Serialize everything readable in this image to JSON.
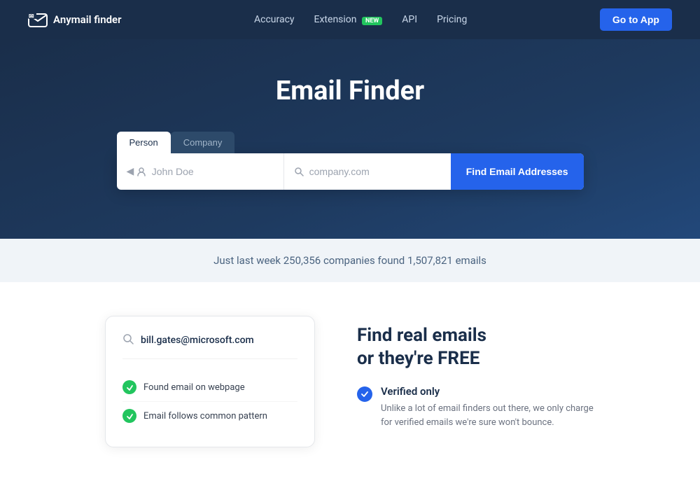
{
  "navbar": {
    "brand": "Anymail finder",
    "nav_links": [
      {
        "label": "Accuracy",
        "id": "accuracy"
      },
      {
        "label": "Extension",
        "id": "extension",
        "badge": "NEW"
      },
      {
        "label": "API",
        "id": "api"
      },
      {
        "label": "Pricing",
        "id": "pricing"
      }
    ],
    "cta_label": "Go to App"
  },
  "hero": {
    "title": "Email Finder",
    "tabs": [
      {
        "label": "Person",
        "active": true
      },
      {
        "label": "Company",
        "active": false
      }
    ],
    "name_placeholder": "John Doe",
    "domain_placeholder": "company.com",
    "find_button": "Find Email Addresses"
  },
  "stats": {
    "text": "Just last week 250,356 companies found 1,507,821 emails"
  },
  "feature_card": {
    "email": "bill.gates@microsoft.com",
    "checks": [
      {
        "label": "Found email on webpage"
      },
      {
        "label": "Email follows common pattern"
      }
    ]
  },
  "feature_text": {
    "title": "Find real emails\nor they're FREE",
    "verified_label": "Verified only",
    "verified_desc": "Unlike a lot of email finders out there, we only charge for verified emails we're sure won't bounce."
  }
}
